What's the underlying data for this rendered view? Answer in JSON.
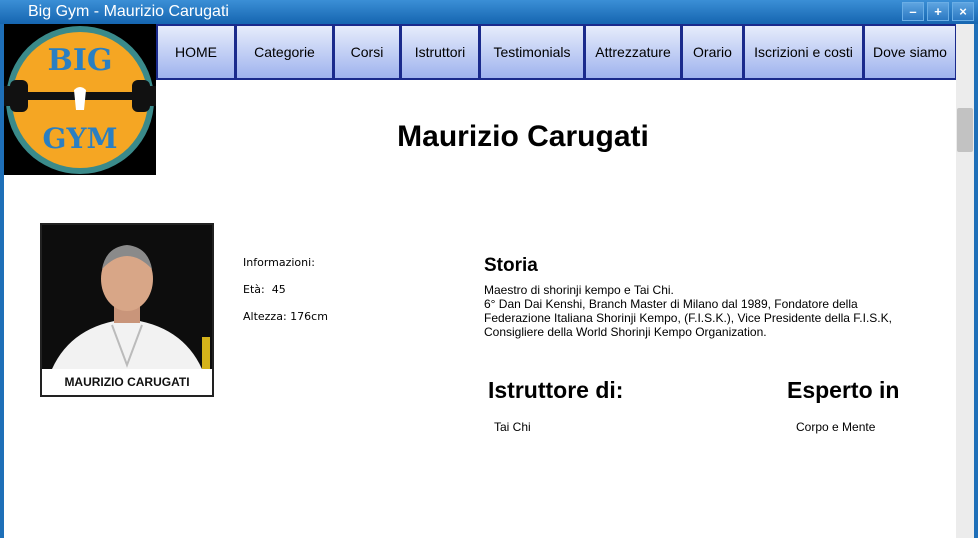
{
  "window": {
    "title": "Big Gym - Maurizio Carugati",
    "controls": [
      "–",
      "+",
      "×"
    ]
  },
  "logo": {
    "top_text": "BIG",
    "bottom_text": "GYM"
  },
  "nav": [
    "HOME",
    "Categorie",
    "Corsi",
    "Istruttori",
    "Testimonials",
    "Attrezzature",
    "Orario",
    "Iscrizioni e costi",
    "Dove siamo"
  ],
  "page": {
    "title": "Maurizio Carugati"
  },
  "photo": {
    "caption": "MAURIZIO CARUGATI"
  },
  "info": {
    "heading": "Informazioni:",
    "eta": "Età:  45",
    "altezza": "Altezza: 176cm"
  },
  "storia": {
    "heading": "Storia",
    "line1": "Maestro di shorinji kempo e Tai Chi.",
    "line2": "6° Dan Dai Kenshi, Branch Master di Milano dal 1989, Fondatore della Federazione Italiana Shorinji Kempo, (F.I.S.K.), Vice Presidente della F.I.S.K, Consigliere della World Shorinji Kempo Organization."
  },
  "istruttore": {
    "heading": "Istruttore di:",
    "value": "Tai Chi"
  },
  "esperto": {
    "heading": "Esperto in",
    "value": "Corpo e Mente"
  }
}
